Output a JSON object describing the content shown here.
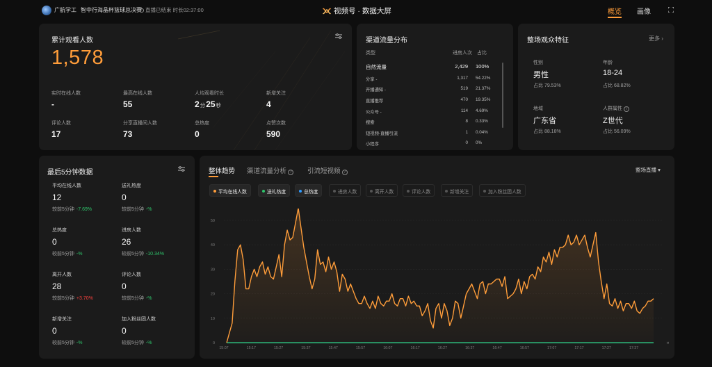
{
  "header": {
    "account_name": "广航学工",
    "match_name": "智中行海晶杯篮球总决赛",
    "live_status": "直播已结束 时长02:37:00",
    "center_title": "视频号 · 数据大屏",
    "nav_tabs": [
      "概览",
      "画像"
    ],
    "active_tab": "概览",
    "accent_color": "#ff9d3a",
    "icons": [
      "account-avatar",
      "live-status-icon",
      "channels-logo-icon",
      "fullscreen-icon"
    ]
  },
  "summary": {
    "title": "累计观看人数",
    "total": "1,578",
    "metrics": [
      {
        "label": "实时在线人数",
        "value": "-"
      },
      {
        "label": "最高在线人数",
        "value": "55"
      },
      {
        "label": "人均观看时长",
        "min": "2",
        "min_unit": "分",
        "sec": "25",
        "sec_unit": "秒"
      },
      {
        "label": "新增关注",
        "value": "4"
      },
      {
        "label": "评论人数",
        "value": "17"
      },
      {
        "label": "分享直播间人数",
        "value": "73"
      },
      {
        "label": "总热度",
        "value": "0"
      },
      {
        "label": "点赞次数",
        "value": "590"
      }
    ]
  },
  "channels": {
    "title": "渠道流量分布",
    "headers": {
      "type": "类型",
      "count": "进房人次",
      "ratio": "占比"
    },
    "rows": [
      {
        "name": "自然流量",
        "count": "2,429",
        "ratio": "100%"
      },
      {
        "name": "分享 -",
        "count": "1,317",
        "ratio": "54.22%"
      },
      {
        "name": "开播通知 -",
        "count": "519",
        "ratio": "21.37%"
      },
      {
        "name": "直播推荐",
        "count": "470",
        "ratio": "19.35%"
      },
      {
        "name": "公众号 -",
        "count": "114",
        "ratio": "4.69%"
      },
      {
        "name": "搜索",
        "count": "8",
        "ratio": "0.33%"
      },
      {
        "name": "短视频-直播引流",
        "count": "1",
        "ratio": "0.04%"
      },
      {
        "name": "小程序",
        "count": "0",
        "ratio": "0%"
      }
    ]
  },
  "audience": {
    "title": "整场观众特征",
    "more": "更多",
    "features": [
      {
        "label": "性别",
        "value": "男性",
        "ratio": "占比 79.53%"
      },
      {
        "label": "年龄",
        "value": "18-24",
        "ratio": "占比 68.82%"
      },
      {
        "label": "地域",
        "value": "广东省",
        "ratio": "占比 88.18%"
      },
      {
        "label": "人群属性",
        "value": "Z世代",
        "ratio": "占比 56.09%"
      }
    ]
  },
  "last5": {
    "title": "最后5分钟数据",
    "compare_prefix": "较前5分钟",
    "items": [
      {
        "label": "平均在线人数",
        "value": "12",
        "change": "-7.69%",
        "trend": "up"
      },
      {
        "label": "送礼热度",
        "value": "0",
        "change": "-%",
        "trend": "up"
      },
      {
        "label": "总热度",
        "value": "0",
        "change": "-%",
        "trend": "up"
      },
      {
        "label": "进房人数",
        "value": "26",
        "change": "-10.34%",
        "trend": "up"
      },
      {
        "label": "离开人数",
        "value": "28",
        "change": "+3.70%",
        "trend": "down"
      },
      {
        "label": "评论人数",
        "value": "0",
        "change": "-%",
        "trend": "up"
      },
      {
        "label": "新增关注",
        "value": "0",
        "change": "-%",
        "trend": "up"
      },
      {
        "label": "加入粉丝团人数",
        "value": "0",
        "change": "-%",
        "trend": "up"
      }
    ]
  },
  "trend": {
    "tabs": [
      "整体趋势",
      "渠道流量分析",
      "引流短视频"
    ],
    "active_tab": "整体趋势",
    "dropdown": "整场直播",
    "legend": [
      {
        "name": "平均在线人数",
        "color": "#ff9d3a",
        "on": true
      },
      {
        "name": "送礼热度",
        "color": "#2fc36b",
        "on": true
      },
      {
        "name": "总热度",
        "color": "#2f9bff",
        "on": true
      },
      {
        "name": "进房人数",
        "color": "#555555",
        "on": false
      },
      {
        "name": "离开人数",
        "color": "#555555",
        "on": false
      },
      {
        "name": "评论人数",
        "color": "#555555",
        "on": false
      },
      {
        "name": "新增关注",
        "color": "#555555",
        "on": false
      },
      {
        "name": "加入粉丝团人数",
        "color": "#555555",
        "on": false
      }
    ]
  },
  "chart_data": {
    "type": "line",
    "title": "",
    "xlabel": "",
    "ylabel": "",
    "x_ticks": [
      "15:07",
      "15:17",
      "15:27",
      "15:37",
      "15:47",
      "15:57",
      "16:07",
      "16:17",
      "16:27",
      "16:37",
      "16:47",
      "16:57",
      "17:07",
      "17:17",
      "17:27",
      "17:37"
    ],
    "y_ticks": [
      0,
      10,
      20,
      30,
      40,
      50
    ],
    "ylim": [
      0,
      52
    ],
    "xlim": [
      0,
      156
    ],
    "x_end_label": "ㅂ",
    "grid": true,
    "legend_position": "top-left",
    "series": [
      {
        "name": "平均在线人数",
        "color": "#ff9d3a",
        "area": true,
        "points": [
          [
            1,
            0
          ],
          [
            2,
            4
          ],
          [
            3,
            8
          ],
          [
            4,
            25
          ],
          [
            5,
            38
          ],
          [
            6,
            40
          ],
          [
            7,
            34
          ],
          [
            8,
            22
          ],
          [
            9,
            22
          ],
          [
            10,
            27
          ],
          [
            11,
            30
          ],
          [
            12,
            27
          ],
          [
            13,
            31
          ],
          [
            14,
            33
          ],
          [
            15,
            28
          ],
          [
            16,
            31
          ],
          [
            17,
            27
          ],
          [
            18,
            26
          ],
          [
            19,
            31
          ],
          [
            20,
            36
          ],
          [
            21,
            27
          ],
          [
            22,
            40
          ],
          [
            23,
            46
          ],
          [
            24,
            42
          ],
          [
            25,
            43
          ],
          [
            26,
            49
          ],
          [
            27,
            55
          ],
          [
            28,
            47
          ],
          [
            29,
            39
          ],
          [
            30,
            33
          ],
          [
            31,
            27
          ],
          [
            32,
            22
          ],
          [
            33,
            26
          ],
          [
            34,
            38
          ],
          [
            35,
            32
          ],
          [
            36,
            33
          ],
          [
            37,
            29
          ],
          [
            38,
            35
          ],
          [
            39,
            30
          ],
          [
            40,
            33
          ],
          [
            41,
            29
          ],
          [
            42,
            21
          ],
          [
            43,
            28
          ],
          [
            44,
            26
          ],
          [
            45,
            21
          ],
          [
            46,
            24
          ],
          [
            47,
            21
          ],
          [
            48,
            18
          ],
          [
            49,
            16
          ],
          [
            50,
            16
          ],
          [
            51,
            19
          ],
          [
            52,
            16
          ],
          [
            53,
            14
          ],
          [
            54,
            17
          ],
          [
            55,
            14
          ],
          [
            56,
            19
          ],
          [
            57,
            16
          ],
          [
            58,
            15
          ],
          [
            59,
            17
          ],
          [
            60,
            17
          ],
          [
            61,
            20
          ],
          [
            62,
            16
          ],
          [
            63,
            15
          ],
          [
            64,
            18
          ],
          [
            65,
            18
          ],
          [
            66,
            15
          ],
          [
            67,
            19
          ],
          [
            68,
            16
          ],
          [
            69,
            17
          ],
          [
            70,
            15
          ],
          [
            71,
            15
          ],
          [
            72,
            11
          ],
          [
            73,
            13
          ],
          [
            74,
            16
          ],
          [
            75,
            9
          ],
          [
            76,
            6
          ],
          [
            77,
            14
          ],
          [
            78,
            16
          ],
          [
            79,
            10
          ],
          [
            80,
            16
          ],
          [
            81,
            13
          ],
          [
            82,
            7
          ],
          [
            83,
            10
          ],
          [
            84,
            17
          ],
          [
            85,
            16
          ],
          [
            86,
            10
          ],
          [
            87,
            15
          ],
          [
            88,
            20
          ],
          [
            89,
            22
          ],
          [
            90,
            24
          ],
          [
            91,
            21
          ],
          [
            92,
            18
          ],
          [
            93,
            24
          ],
          [
            94,
            25
          ],
          [
            95,
            20
          ],
          [
            96,
            24
          ],
          [
            97,
            24
          ],
          [
            98,
            25
          ],
          [
            99,
            26
          ],
          [
            100,
            26
          ],
          [
            101,
            23
          ],
          [
            102,
            27
          ],
          [
            103,
            18
          ],
          [
            104,
            19
          ],
          [
            105,
            20
          ],
          [
            106,
            22
          ],
          [
            107,
            26
          ],
          [
            108,
            20
          ],
          [
            109,
            25
          ],
          [
            110,
            22
          ],
          [
            111,
            27
          ],
          [
            112,
            28
          ],
          [
            113,
            26
          ],
          [
            114,
            31
          ],
          [
            115,
            29
          ],
          [
            116,
            35
          ],
          [
            117,
            33
          ],
          [
            118,
            37
          ],
          [
            119,
            32
          ],
          [
            120,
            38
          ],
          [
            121,
            35
          ],
          [
            122,
            39
          ],
          [
            123,
            39
          ],
          [
            124,
            40
          ],
          [
            125,
            44
          ],
          [
            126,
            40
          ],
          [
            127,
            41
          ],
          [
            128,
            44
          ],
          [
            129,
            40
          ],
          [
            130,
            42
          ],
          [
            131,
            44
          ],
          [
            132,
            39
          ],
          [
            133,
            35
          ],
          [
            134,
            40
          ],
          [
            135,
            45
          ],
          [
            136,
            33
          ],
          [
            137,
            25
          ],
          [
            138,
            18
          ],
          [
            139,
            24
          ],
          [
            140,
            16
          ],
          [
            141,
            15
          ],
          [
            142,
            18
          ],
          [
            143,
            14
          ],
          [
            144,
            17
          ],
          [
            145,
            13
          ],
          [
            146,
            16
          ],
          [
            147,
            16
          ],
          [
            148,
            14
          ],
          [
            149,
            17
          ],
          [
            150,
            13
          ],
          [
            151,
            12
          ],
          [
            152,
            14
          ],
          [
            153,
            15
          ],
          [
            154,
            17
          ],
          [
            155,
            17
          ],
          [
            156,
            18
          ]
        ]
      },
      {
        "name": "送礼热度",
        "color": "#2fc36b",
        "area": false,
        "points": [
          [
            1,
            0
          ],
          [
            156,
            0
          ]
        ]
      },
      {
        "name": "总热度",
        "color": "#2f9bff",
        "area": false,
        "points": [
          [
            1,
            0
          ],
          [
            156,
            0
          ]
        ]
      }
    ]
  }
}
